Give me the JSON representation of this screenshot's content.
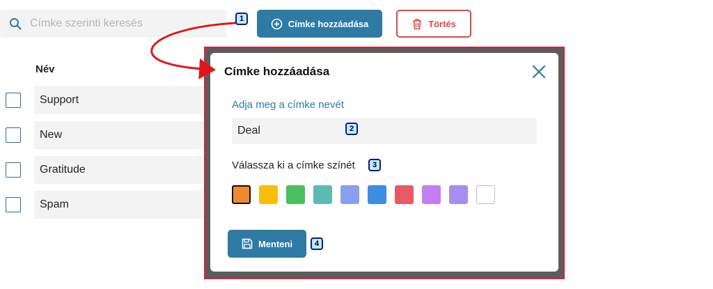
{
  "toolbar": {
    "search_placeholder": "Címke szerinti keresés",
    "add_button_label": "Címke hozzáadása",
    "delete_button_label": "Törtés"
  },
  "list": {
    "column_header": "Név",
    "rows": [
      {
        "label": "Support"
      },
      {
        "label": "New"
      },
      {
        "label": "Gratitude"
      },
      {
        "label": "Spam"
      }
    ]
  },
  "modal": {
    "title": "Címke hozzáadása",
    "name_label": "Adja meg a címke nevét",
    "name_value": "Deal",
    "color_label": "Válassza ki a címke színét",
    "colors": [
      "#f0892b",
      "#f8be0c",
      "#4cbf62",
      "#5cbcb2",
      "#8aa0ef",
      "#3d8ee0",
      "#e85a63",
      "#c37ff1",
      "#a58ef0",
      "#ffffff"
    ],
    "selected_color_index": 0,
    "save_button_label": "Menteni"
  },
  "callouts": [
    "1",
    "2",
    "3",
    "4"
  ],
  "accent_color": "#2e7aa5",
  "danger_color": "#e04646"
}
